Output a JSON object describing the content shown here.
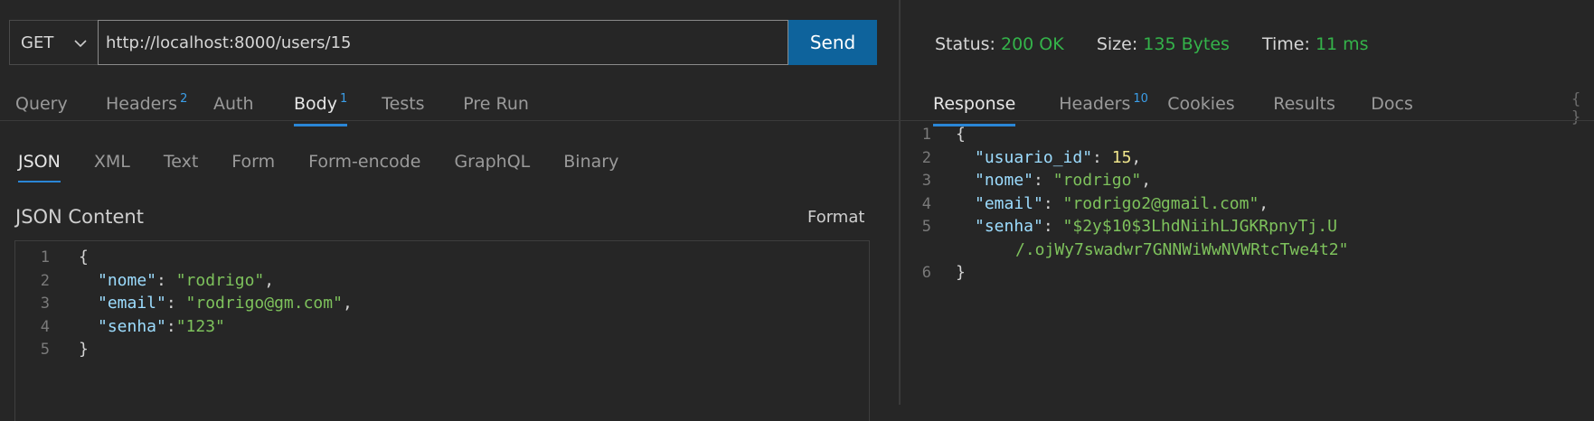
{
  "request": {
    "method": "GET",
    "url": "http://localhost:8000/users/15",
    "send_label": "Send"
  },
  "request_tabs": [
    {
      "label": "Query",
      "badge": ""
    },
    {
      "label": "Headers",
      "badge": "2"
    },
    {
      "label": "Auth",
      "badge": ""
    },
    {
      "label": "Body",
      "badge": "1"
    },
    {
      "label": "Tests",
      "badge": ""
    },
    {
      "label": "Pre Run",
      "badge": ""
    }
  ],
  "body_tabs": [
    "JSON",
    "XML",
    "Text",
    "Form",
    "Form-encode",
    "GraphQL",
    "Binary"
  ],
  "body": {
    "title": "JSON Content",
    "format_label": "Format",
    "line_numbers": [
      "1",
      "2",
      "3",
      "4",
      "5"
    ],
    "lines": [
      [
        {
          "t": "brace",
          "v": "{"
        }
      ],
      [
        {
          "t": "key",
          "v": "\"nome\""
        },
        {
          "t": "punc",
          "v": ": "
        },
        {
          "t": "str",
          "v": "\"rodrigo\""
        },
        {
          "t": "punc",
          "v": ","
        }
      ],
      [
        {
          "t": "key",
          "v": "\"email\""
        },
        {
          "t": "punc",
          "v": ": "
        },
        {
          "t": "str",
          "v": "\"rodrigo@gm.com\""
        },
        {
          "t": "punc",
          "v": ","
        }
      ],
      [
        {
          "t": "key",
          "v": "\"senha\""
        },
        {
          "t": "punc",
          "v": ":"
        },
        {
          "t": "str",
          "v": "\"123\""
        }
      ],
      [
        {
          "t": "brace",
          "v": "}"
        }
      ]
    ]
  },
  "response_status": {
    "status_label": "Status:",
    "status_value": "200 OK",
    "size_label": "Size:",
    "size_value": "135 Bytes",
    "time_label": "Time:",
    "time_value": "11 ms"
  },
  "response_tabs": [
    {
      "label": "Response",
      "badge": ""
    },
    {
      "label": "Headers",
      "badge": "10"
    },
    {
      "label": "Cookies",
      "badge": ""
    },
    {
      "label": "Results",
      "badge": ""
    },
    {
      "label": "Docs",
      "badge": ""
    }
  ],
  "response_icon": "{ }",
  "response": {
    "line_numbers": [
      "1",
      "2",
      "3",
      "4",
      "5",
      "6"
    ],
    "lines": [
      [
        {
          "t": "brace",
          "v": "{"
        }
      ],
      [
        {
          "t": "key",
          "v": "\"usuario_id\""
        },
        {
          "t": "punc",
          "v": ": "
        },
        {
          "t": "num",
          "v": "15"
        },
        {
          "t": "punc",
          "v": ","
        }
      ],
      [
        {
          "t": "key",
          "v": "\"nome\""
        },
        {
          "t": "punc",
          "v": ": "
        },
        {
          "t": "str",
          "v": "\"rodrigo\""
        },
        {
          "t": "punc",
          "v": ","
        }
      ],
      [
        {
          "t": "key",
          "v": "\"email\""
        },
        {
          "t": "punc",
          "v": ": "
        },
        {
          "t": "str",
          "v": "\"rodrigo2@gmail.com\""
        },
        {
          "t": "punc",
          "v": ","
        }
      ],
      [
        {
          "t": "key",
          "v": "\"senha\""
        },
        {
          "t": "punc",
          "v": ": "
        },
        {
          "t": "str",
          "v": "\"$2y$10$3LhdNiihLJGKRpnyTj.U"
        }
      ],
      [
        {
          "t": "str",
          "v": "/.ojWy7swadwr7GNNWiWwNVWRtcTwe4t2\""
        }
      ],
      [
        {
          "t": "brace",
          "v": "}"
        }
      ]
    ]
  }
}
